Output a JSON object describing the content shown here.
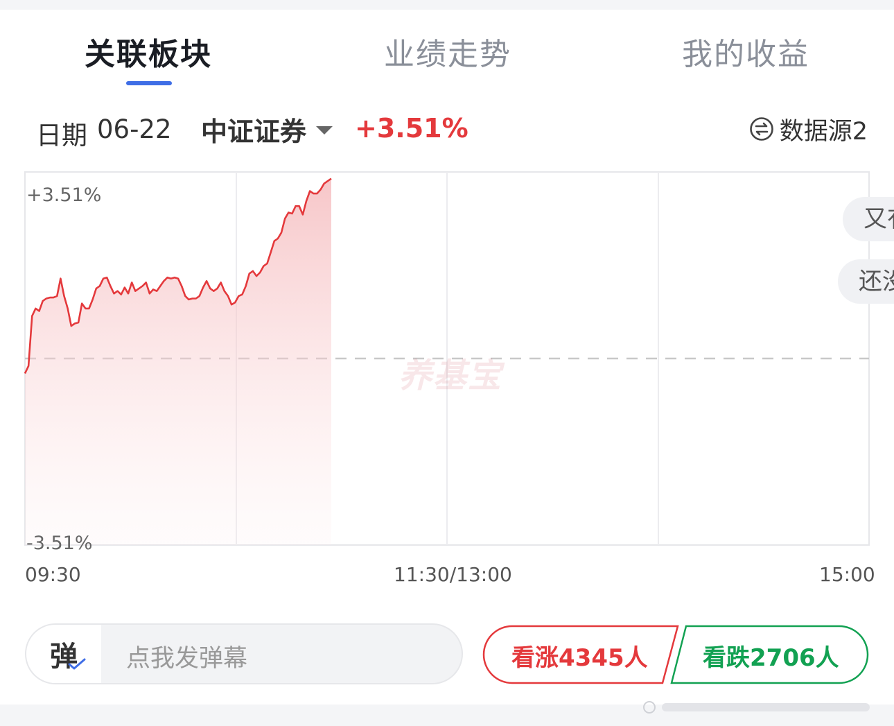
{
  "tabs": [
    {
      "label": "关联板块",
      "active": true
    },
    {
      "label": "业绩走势",
      "active": false
    },
    {
      "label": "我的收益",
      "active": false
    }
  ],
  "info": {
    "date_label": "日期",
    "date_value": "06-22",
    "index_name": "中证证券",
    "index_change": "+3.51%",
    "source_label": "数据源2"
  },
  "side_buttons": [
    "又有",
    "还没"
  ],
  "watermark": "养基宝",
  "chart_data": {
    "type": "line",
    "ylim": [
      -3.51,
      3.51
    ],
    "y_tick_labels": [
      "+3.51%",
      "-3.51%"
    ],
    "x_tick_labels": [
      "09:30",
      "11:30/13:00",
      "15:00"
    ],
    "baseline": 0,
    "colors": {
      "line": "#e4393c",
      "fill": "#f7c9cb",
      "baseline": "#c8c8c8"
    },
    "series": [
      {
        "x_minutes": [
          0,
          1,
          2,
          3,
          4,
          5,
          6,
          7,
          8,
          9,
          10,
          11,
          12,
          13,
          14,
          15,
          16,
          17,
          18,
          19,
          20,
          21,
          22,
          23,
          24,
          25,
          26,
          27,
          28,
          29,
          30,
          31,
          32,
          33,
          34,
          35,
          36,
          37,
          38,
          39,
          40,
          41,
          42,
          43,
          44,
          45,
          46,
          47,
          48,
          49,
          50,
          51,
          52,
          53,
          54,
          55,
          56,
          57,
          58,
          59,
          60,
          61,
          62,
          63,
          64,
          65,
          66,
          67,
          68,
          69,
          70,
          71,
          72,
          73,
          74,
          75,
          76,
          77,
          78,
          79,
          80,
          81,
          82,
          83,
          84,
          85,
          86
        ],
        "values": [
          -0.3,
          -0.15,
          0.85,
          1.0,
          0.95,
          1.15,
          1.2,
          1.22,
          1.22,
          1.25,
          1.6,
          1.25,
          1.0,
          0.65,
          0.7,
          0.72,
          1.1,
          1.0,
          1.0,
          1.18,
          1.4,
          1.45,
          1.6,
          1.62,
          1.45,
          1.3,
          1.35,
          1.28,
          1.42,
          1.3,
          1.52,
          1.35,
          1.4,
          1.45,
          1.52,
          1.3,
          1.38,
          1.35,
          1.45,
          1.55,
          1.62,
          1.6,
          1.62,
          1.6,
          1.45,
          1.25,
          1.18,
          1.2,
          1.2,
          1.25,
          1.42,
          1.55,
          1.4,
          1.35,
          1.4,
          1.52,
          1.35,
          1.25,
          1.08,
          1.12,
          1.25,
          1.28,
          1.45,
          1.7,
          1.75,
          1.65,
          1.72,
          1.85,
          1.9,
          2.12,
          2.35,
          2.4,
          2.52,
          2.8,
          2.92,
          2.9,
          3.05,
          3.05,
          2.88,
          3.15,
          3.35,
          3.3,
          3.3,
          3.38,
          3.5,
          3.55,
          3.6
        ]
      }
    ],
    "total_minutes": 240
  },
  "danmu": {
    "badge": "弹",
    "placeholder": "点我发弹幕"
  },
  "votes": {
    "up_label": "看涨4345人",
    "down_label": "看跌2706人",
    "up_color": "#e4393c",
    "down_color": "#12a152"
  }
}
